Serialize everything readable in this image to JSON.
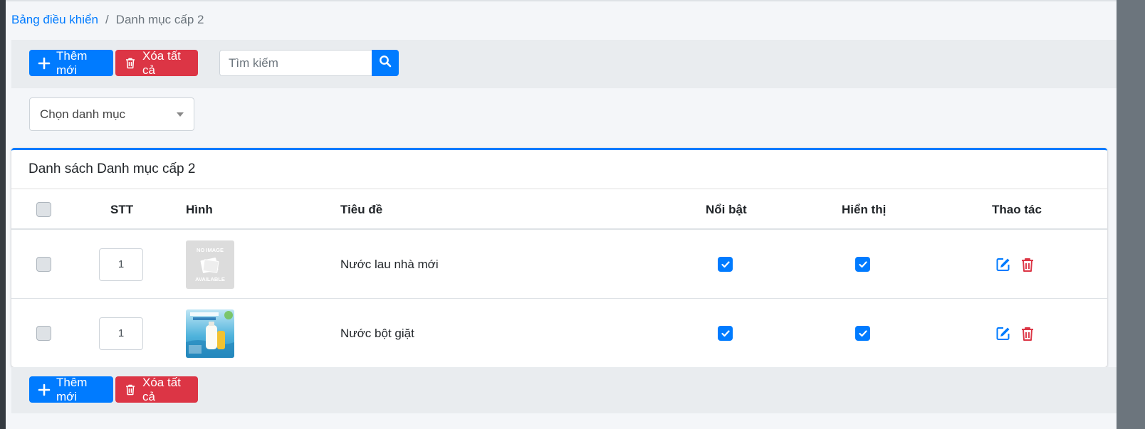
{
  "breadcrumb": {
    "home": "Bảng điều khiển",
    "separator": "/",
    "current": "Danh mục cấp 2"
  },
  "toolbar": {
    "add_label": "Thêm mới",
    "delete_all_label": "Xóa tất cả",
    "search_placeholder": "Tìm kiếm"
  },
  "filter": {
    "category_select": "Chọn danh mục"
  },
  "card": {
    "title": "Danh sách Danh mục cấp 2"
  },
  "table": {
    "headers": {
      "stt": "STT",
      "image": "Hình",
      "title": "Tiêu đề",
      "featured": "Nổi bật",
      "visible": "Hiển thị",
      "actions": "Thao tác"
    },
    "rows": [
      {
        "stt": "1",
        "title": "Nước lau nhà mới",
        "image_icon": "no-image-placeholder",
        "no_image_top": "NO IMAGE",
        "no_image_bottom": "AVAILABLE",
        "featured": true,
        "visible": true
      },
      {
        "stt": "1",
        "title": "Nước bột giặt",
        "image_icon": "product-photo",
        "featured": true,
        "visible": true
      }
    ]
  },
  "footer": {
    "add_label": "Thêm mới",
    "delete_all_label": "Xóa tất cả"
  },
  "colors": {
    "primary": "#007bff",
    "danger": "#dc3545",
    "background": "#f4f6f9",
    "toolbar": "#e9ecef"
  },
  "icons": {
    "add": "plus-icon",
    "delete_all": "trash-icon",
    "search": "search-icon",
    "edit": "edit-icon",
    "delete": "trash-icon"
  }
}
